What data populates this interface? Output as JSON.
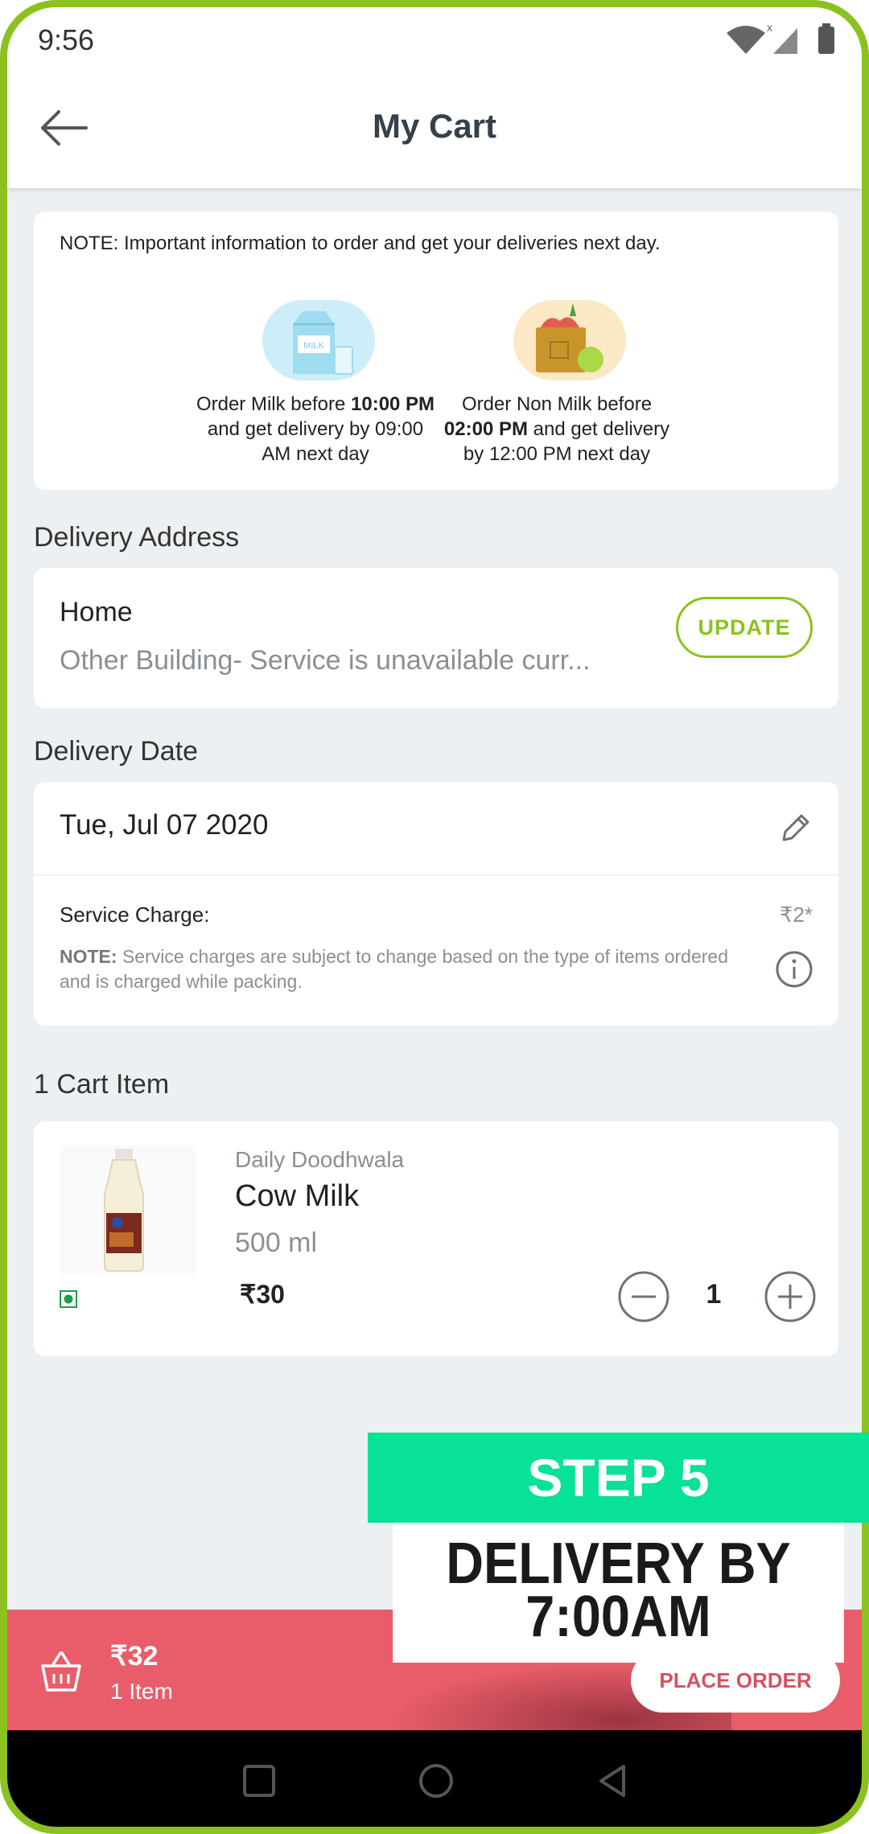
{
  "status_bar": {
    "time": "9:56"
  },
  "header": {
    "title": "My Cart"
  },
  "note_card": {
    "note": "NOTE: Important information to order and get your deliveries next day.",
    "milk": {
      "pre": "Order Milk before ",
      "time1": "10:00 PM",
      "mid": " and get delivery by ",
      "time2": "09:00 AM next day"
    },
    "non_milk": {
      "pre": "Order Non Milk before ",
      "time1": "02:00 PM",
      "mid": " and get delivery by ",
      "time2": "12:00 PM next day"
    }
  },
  "delivery_address": {
    "section_title": "Delivery Address",
    "name": "Home",
    "line": "Other Building- Service is unavailable curr...",
    "update_label": "UPDATE"
  },
  "delivery_date": {
    "section_title": "Delivery Date",
    "date": "Tue, Jul 07 2020",
    "service_label": "Service Charge:",
    "service_amount": "₹2*",
    "note_label": "NOTE:",
    "note_text": " Service charges are subject to change based on the type of items ordered and is charged while packing."
  },
  "cart": {
    "section_title": "1 Cart Item",
    "item": {
      "brand": "Daily Doodhwala",
      "name": "Cow Milk",
      "size": "500 ml",
      "price": "₹30",
      "quantity": "1"
    }
  },
  "bottom_bar": {
    "total": "₹32",
    "items": "1 Item",
    "button": "PLACE ORDER"
  },
  "promo": {
    "step": "STEP 5",
    "line1": "DELIVERY BY",
    "line2": "7:00AM"
  },
  "colors": {
    "accent": "#8cc21f",
    "checkout_bar": "#e95d6a",
    "promo_green": "#07e296"
  },
  "icons": [
    "wifi-icon",
    "signal-icon",
    "battery-icon",
    "back-arrow-icon",
    "milk-carton-icon",
    "grocery-bag-icon",
    "edit-pencil-icon",
    "info-icon",
    "veg-icon",
    "minus-icon",
    "plus-icon",
    "basket-icon",
    "nav-recents-icon",
    "nav-home-icon",
    "nav-back-icon"
  ]
}
